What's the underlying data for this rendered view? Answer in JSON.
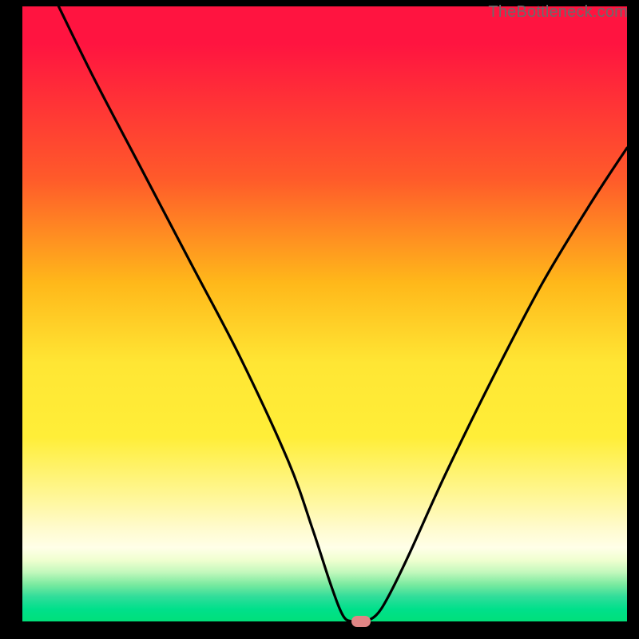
{
  "watermark": {
    "text": "TheBottleneck.com"
  },
  "chart_data": {
    "type": "line",
    "title": "",
    "xlabel": "",
    "ylabel": "",
    "xlim": [
      0,
      100
    ],
    "ylim": [
      0,
      100
    ],
    "grid": false,
    "series": [
      {
        "name": "bottleneck-curve",
        "x": [
          6,
          12,
          20,
          28,
          36,
          44,
          48,
          51,
          53,
          54.5,
          56.5,
          58.5,
          60.5,
          64,
          70,
          78,
          86,
          94,
          100
        ],
        "y": [
          100,
          88,
          73,
          58,
          43,
          26,
          15,
          6,
          1,
          0,
          0,
          1,
          4,
          11,
          24,
          40,
          55,
          68,
          77
        ]
      }
    ],
    "marker": {
      "x": 56,
      "y": 0,
      "color": "#e08585"
    },
    "background": "heatmap-gradient-red-yellow-green"
  }
}
